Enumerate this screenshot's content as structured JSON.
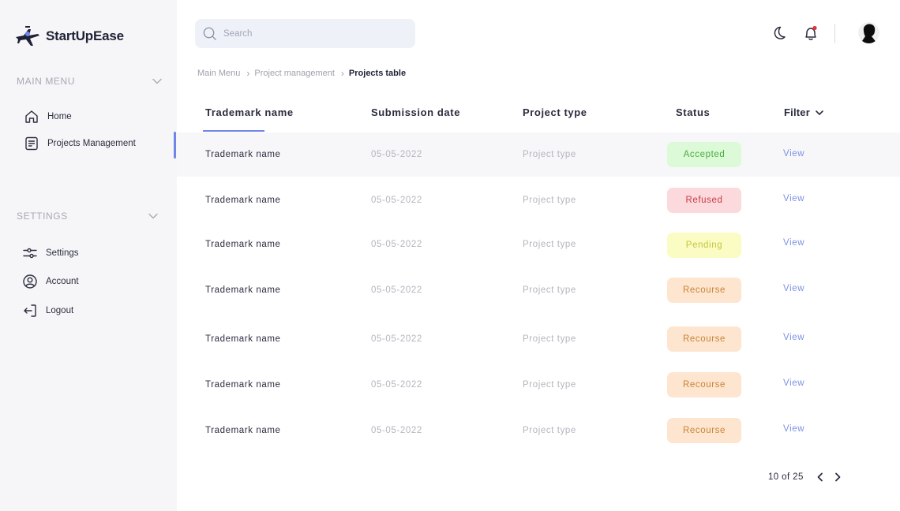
{
  "brand": {
    "name": "StartUpEase"
  },
  "sidebar": {
    "main_menu_label": "MAIN MENU",
    "main_items": [
      {
        "label": "Home",
        "icon": "home-icon"
      },
      {
        "label": "Projects Management",
        "icon": "document-icon",
        "active": true
      }
    ],
    "settings_label": "SETTINGS",
    "settings_items": [
      {
        "label": "Settings",
        "icon": "sliders-icon"
      },
      {
        "label": "Account",
        "icon": "user-circle-icon"
      },
      {
        "label": "Logout",
        "icon": "logout-icon"
      }
    ],
    "accent_color": "#6f86e8"
  },
  "header": {
    "search": {
      "placeholder": "Search",
      "value": ""
    },
    "icons": [
      "moon-icon",
      "bell-icon"
    ],
    "notification_dot_color": "#e0343a"
  },
  "breadcrumb": {
    "items": [
      "Main Menu",
      "Project management",
      "Projects table"
    ]
  },
  "table": {
    "columns": [
      "Trademark name",
      "Submission date",
      "Project type",
      "Status",
      "Filter"
    ],
    "rows": [
      {
        "name": "Trademark name",
        "date": "05-05-2022",
        "type": "Project type",
        "status": "Accepted",
        "action": "View"
      },
      {
        "name": "Trademark name",
        "date": "05-05-2022",
        "type": "Project type",
        "status": "Refused",
        "action": "View"
      },
      {
        "name": "Trademark name",
        "date": "05-05-2022",
        "type": "Project type",
        "status": "Pending",
        "action": "View"
      },
      {
        "name": "Trademark name",
        "date": "05-05-2022",
        "type": "Project type",
        "status": "Recourse",
        "action": "View"
      },
      {
        "name": "Trademark name",
        "date": "05-05-2022",
        "type": "Project type",
        "status": "Recourse",
        "action": "View"
      },
      {
        "name": "Trademark name",
        "date": "05-05-2022",
        "type": "Project type",
        "status": "Recourse",
        "action": "View"
      },
      {
        "name": "Trademark name",
        "date": "05-05-2022",
        "type": "Project type",
        "status": "Recourse",
        "action": "View"
      }
    ],
    "status_colors": {
      "Accepted": "#4caa3f",
      "Refused": "#cc3a45",
      "Pending": "#c8c43f",
      "Recourse": "#c98534"
    }
  },
  "pagination": {
    "text": "10 of 25"
  }
}
